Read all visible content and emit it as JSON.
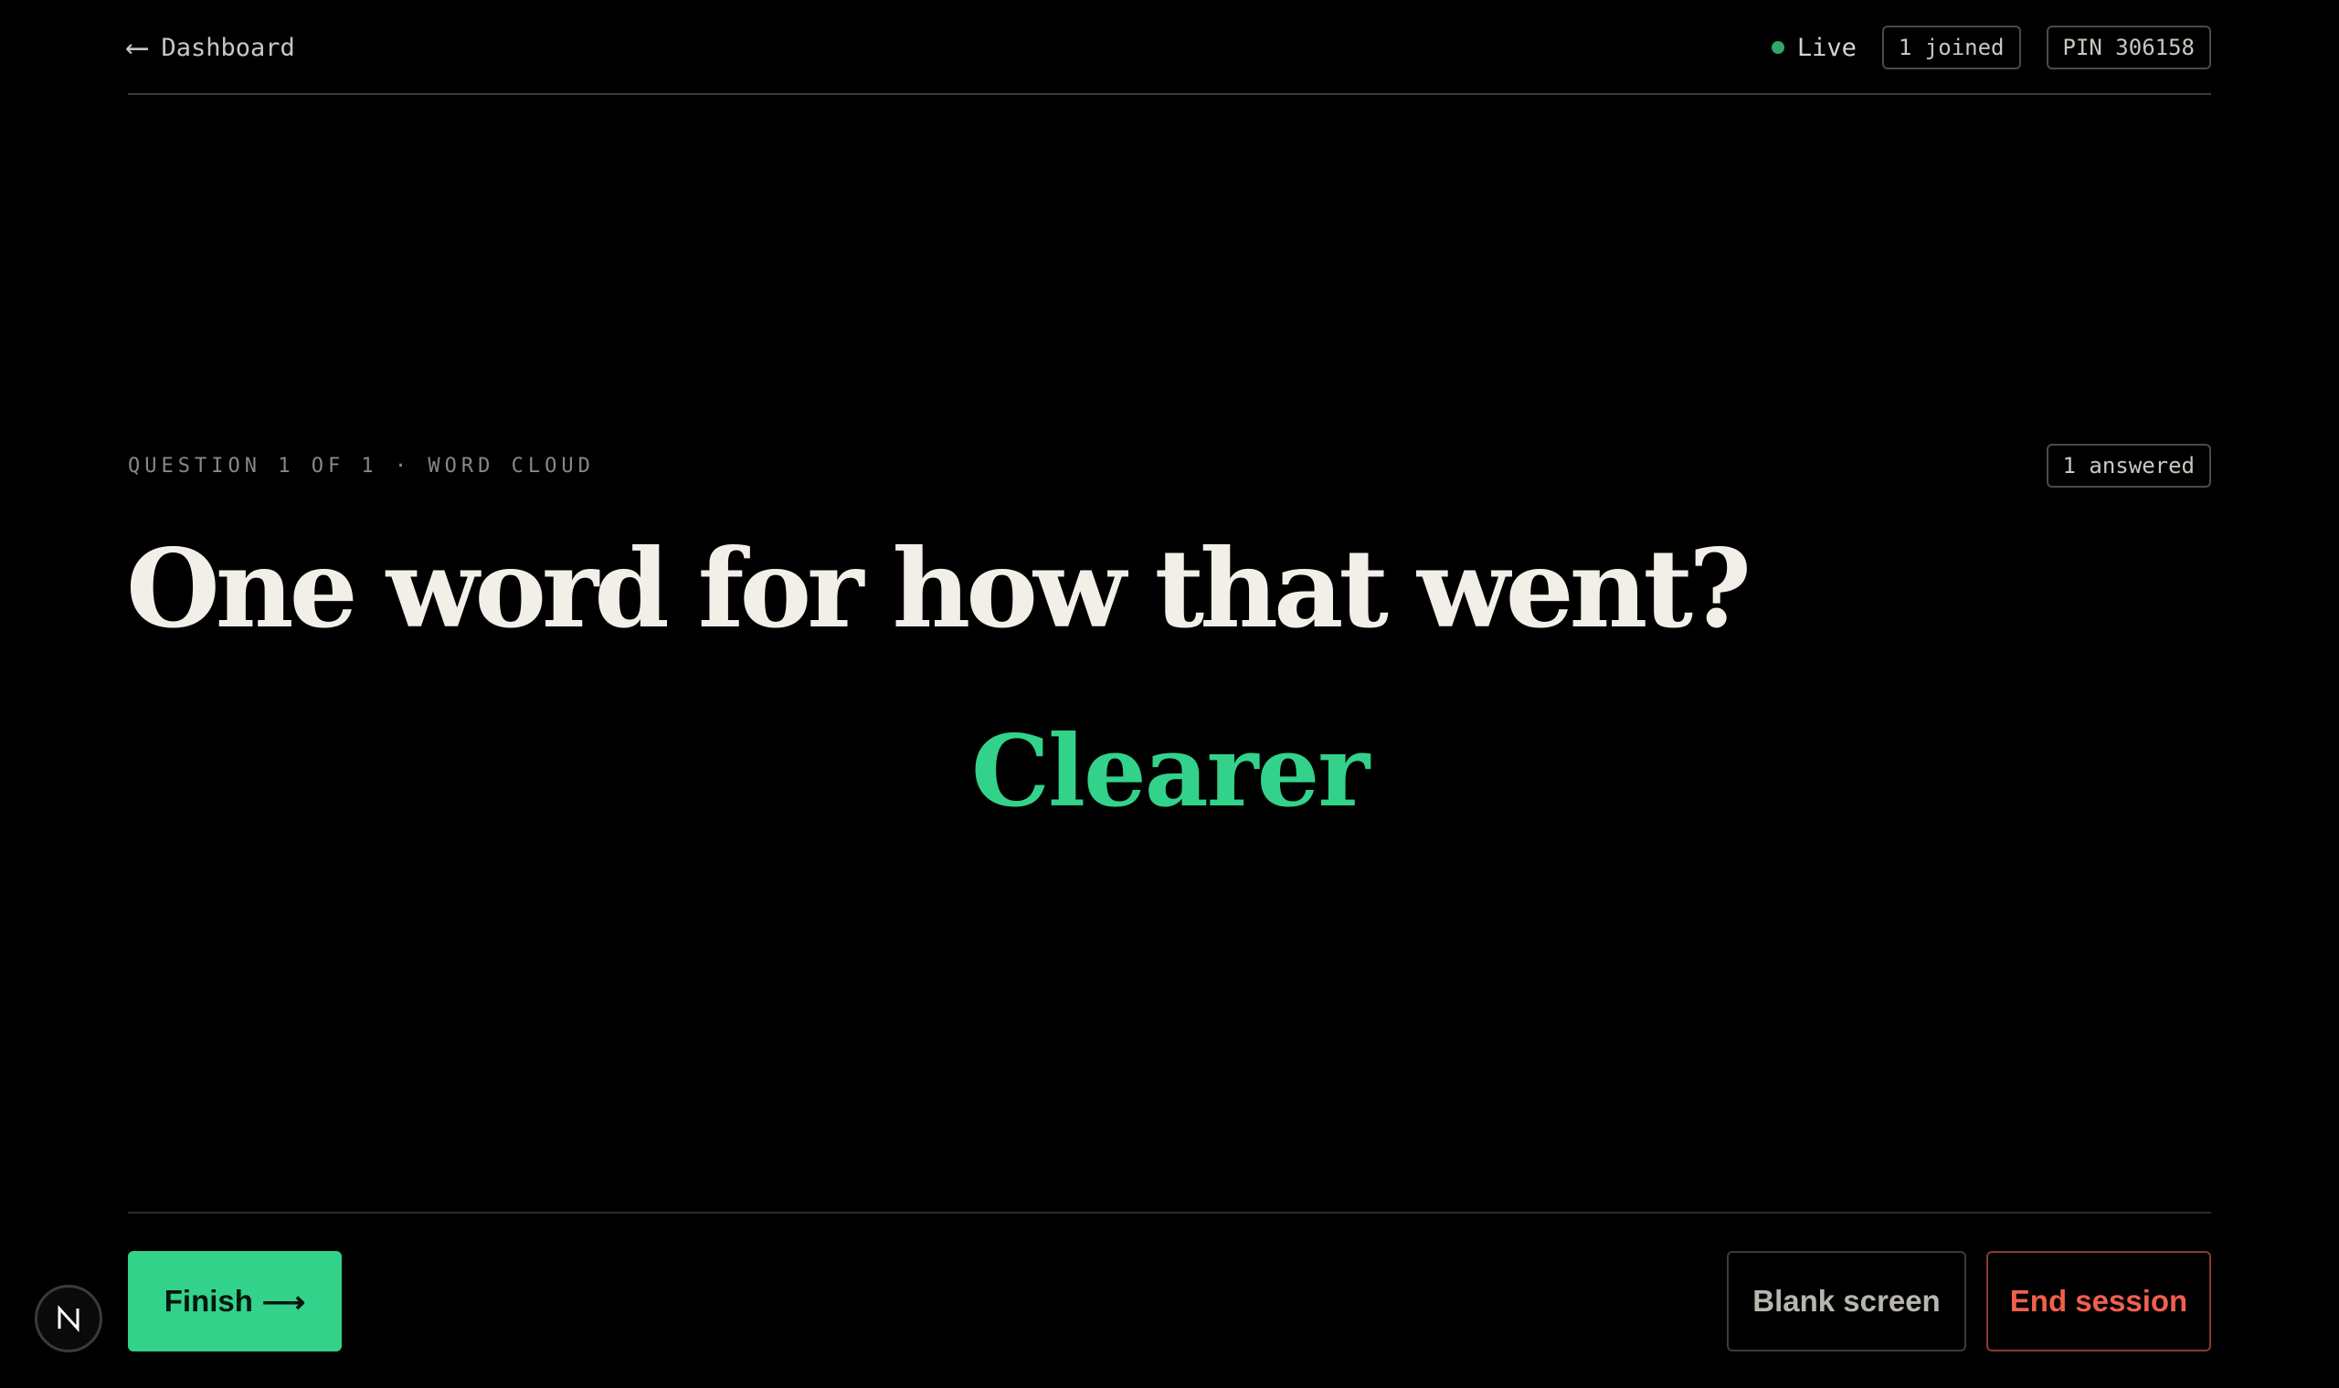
{
  "header": {
    "back_arrow": "⟵",
    "back_label": "Dashboard",
    "status_label": "Live",
    "joined": "1 joined",
    "pin": "PIN 306158"
  },
  "question": {
    "meta": "QUESTION 1 OF 1 · WORD CLOUD",
    "answered": "1 answered",
    "title": "One word for how that went?"
  },
  "word_cloud": {
    "words": [
      {
        "text": "Clearer",
        "count": 1
      }
    ]
  },
  "footer": {
    "finish_label": "Finish",
    "finish_arrow": "⟶",
    "blank_label": "Blank screen",
    "end_label": "End session"
  },
  "colors": {
    "background": "#000000",
    "accent": "#33d28b",
    "cloud_word": "#33d28b",
    "danger": "#f0604c",
    "live_dot": "#2fa869",
    "title_text": "#f1efe7"
  },
  "icons": {
    "back": "arrow-left-icon",
    "live": "status-dot-icon",
    "finish": "arrow-right-icon",
    "badge": "n-logo-icon"
  }
}
